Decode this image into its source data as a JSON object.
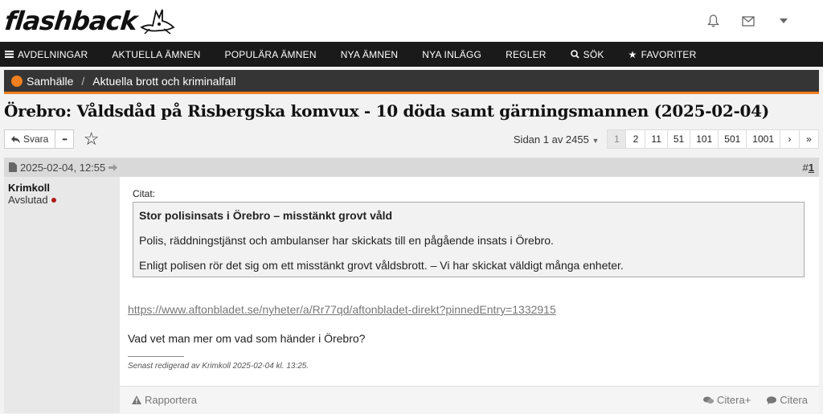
{
  "header": {
    "logo_text": "flashback"
  },
  "nav": [
    {
      "label": "Avdelningar",
      "icon": "menu-icon"
    },
    {
      "label": "Aktuella ämnen"
    },
    {
      "label": "Populära ämnen"
    },
    {
      "label": "Nya ämnen"
    },
    {
      "label": "Nya inlägg"
    },
    {
      "label": "Regler"
    },
    {
      "label": "Sök",
      "icon": "search-icon"
    },
    {
      "label": "Favoriter",
      "icon": "star-icon"
    }
  ],
  "breadcrumb": {
    "section": "Samhälle",
    "separator": "/",
    "forum": "Aktuella brott och kriminalfall"
  },
  "thread": {
    "title": "Örebro: Våldsdåd på Risbergska komvux - 10 döda samt gärningsmannen (2025-02-04)"
  },
  "toolbar": {
    "reply_label": "Svara",
    "more_label": "•••"
  },
  "pager": {
    "info": "Sidan 1 av 2455",
    "pages": [
      "1",
      "2",
      "11",
      "51",
      "101",
      "501",
      "1001"
    ],
    "current": "1",
    "next": "›",
    "last": "»"
  },
  "post": {
    "date": "2025-02-04, 12:55",
    "number_prefix": "#",
    "number": "1",
    "author": "Krimkoll",
    "author_status": "Avslutad",
    "quote_label": "Citat:",
    "quote_title": "Stor polisinsats i Örebro – misstänkt grovt våld",
    "quote_p1": "Polis, räddningstjänst och ambulanser har skickats till en pågående insats i Örebro.",
    "quote_p2": "Enligt polisen rör det sig om ett misstänkt grovt våldsbrott. – Vi har skickat väldigt många enheter.",
    "link": "https://www.aftonbladet.se/nyheter/a/Rr77qd/aftonbladet-direkt?pinnedEntry=1332915",
    "text": "Vad vet man mer om vad som händer i Örebro?",
    "edited": "Senast redigerad av Krimkoll 2025-02-04 kl. 13:25.",
    "report_label": "Rapportera",
    "quote_plus_label": "Citera+",
    "quote_action_label": "Citera"
  },
  "colors": {
    "accent": "#f07f1f",
    "nav_bg": "#1a1a1a",
    "crumb_bg": "#353535"
  }
}
